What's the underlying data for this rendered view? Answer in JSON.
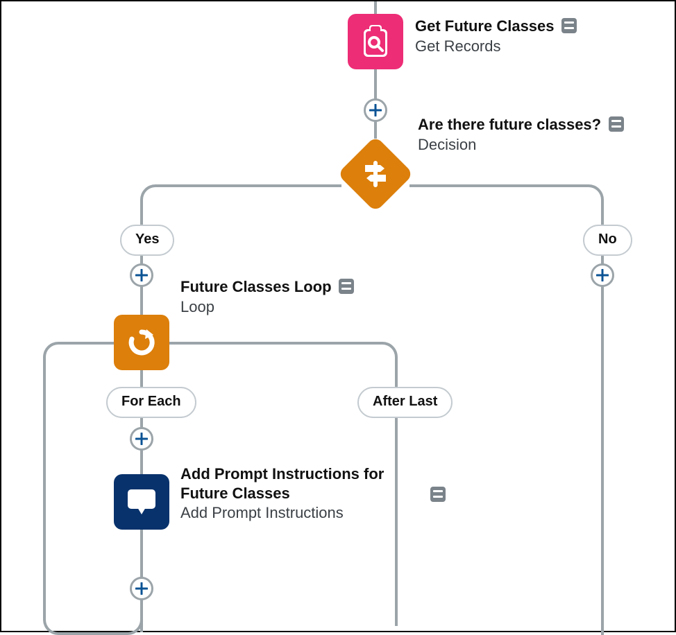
{
  "nodes": {
    "getFutureClasses": {
      "title": "Get Future Classes",
      "subtitle": "Get Records"
    },
    "areThereFutureClasses": {
      "title": "Are there future classes?",
      "subtitle": "Decision"
    },
    "futureClassesLoop": {
      "title": "Future Classes Loop",
      "subtitle": "Loop"
    },
    "addPromptInstructions": {
      "title": "Add Prompt Instructions for Future Classes",
      "subtitle": "Add Prompt Instructions"
    }
  },
  "branches": {
    "yes": "Yes",
    "no": "No",
    "forEach": "For Each",
    "afterLast": "After Last"
  },
  "colors": {
    "pink": "#ed2d76",
    "orange": "#dc7f0b",
    "navy": "#08326c",
    "connector": "#9ba4a9",
    "plus": "#0b5394"
  }
}
